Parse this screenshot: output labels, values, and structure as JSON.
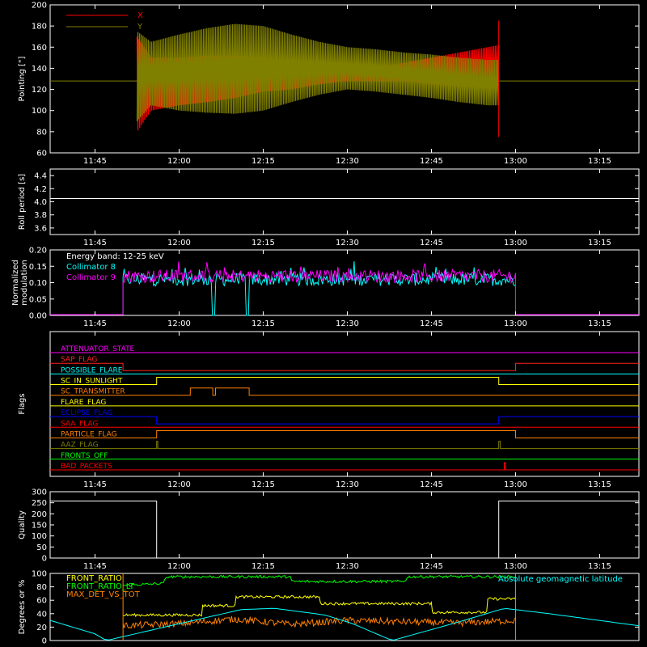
{
  "chart_data": [
    {
      "type": "line",
      "ylabel": "Pointing [\"]",
      "ylim": [
        60,
        200
      ],
      "yticks": [
        "60",
        "80",
        "100",
        "120",
        "140",
        "160",
        "180",
        "200"
      ],
      "xticks": [
        "11:45",
        "12:00",
        "12:15",
        "12:30",
        "12:45",
        "13:00",
        "13:15"
      ],
      "legend_position": "top-left",
      "series": [
        {
          "name": "X",
          "color": "#ff0000",
          "x": [
            "11:52.5",
            "11:55",
            "12:00",
            "12:05",
            "12:10",
            "12:15",
            "12:20",
            "12:25",
            "12:30",
            "12:35",
            "12:40",
            "12:45",
            "12:50",
            "12:55",
            "12:57"
          ],
          "upper": [
            170,
            150,
            150,
            152,
            152,
            150,
            145,
            143,
            140,
            141,
            145,
            150,
            155,
            160,
            162
          ],
          "lower": [
            80,
            100,
            105,
            108,
            112,
            118,
            120,
            125,
            128,
            128,
            128,
            125,
            123,
            122,
            122
          ]
        },
        {
          "name": "Y",
          "color": "#808000",
          "x": [
            "11:52.5",
            "11:55",
            "12:00",
            "12:05",
            "12:10",
            "12:15",
            "12:20",
            "12:25",
            "12:30",
            "12:35",
            "12:40",
            "12:45",
            "12:50",
            "12:55",
            "12:57"
          ],
          "upper": [
            175,
            165,
            172,
            178,
            182,
            180,
            172,
            165,
            160,
            158,
            155,
            153,
            150,
            148,
            148
          ],
          "lower": [
            90,
            105,
            100,
            98,
            97,
            100,
            108,
            115,
            120,
            118,
            115,
            112,
            108,
            105,
            105
          ],
          "baseline": 128
        }
      ]
    },
    {
      "type": "line",
      "ylabel": "Roll period [s]",
      "ylim": [
        3.5,
        4.5
      ],
      "yticks": [
        "3.6",
        "3.8",
        "4.0",
        "4.2",
        "4.4"
      ],
      "xticks": [
        "11:45",
        "12:00",
        "12:15",
        "12:30",
        "12:45",
        "13:00",
        "13:15"
      ],
      "series": [
        {
          "name": "",
          "color": "#ffffff",
          "x": [
            "11:37",
            "13:22"
          ],
          "y": [
            4.05,
            4.05
          ]
        }
      ]
    },
    {
      "type": "line",
      "ylabel": "Normalized modulation",
      "ylim": [
        0.0,
        0.2
      ],
      "yticks": [
        "0.00",
        "0.05",
        "0.10",
        "0.15",
        "0.20"
      ],
      "xticks": [
        "11:45",
        "12:00",
        "12:15",
        "12:30",
        "12:45",
        "13:00",
        "13:15"
      ],
      "annotation": "Energy band: 12-25 keV",
      "legend_position": "top-left",
      "series": [
        {
          "name": "Collimator 8",
          "color": "#00ffff",
          "x_start": "11:50",
          "x_end": "13:00",
          "mean": 0.11,
          "dropouts": [
            [
              "12:06",
              "12:06.3"
            ],
            [
              "12:12",
              "12:12.3"
            ]
          ]
        },
        {
          "name": "Collimator 9",
          "color": "#ff00ff",
          "x_start": "11:50",
          "x_end": "13:00",
          "mean": 0.12
        }
      ]
    },
    {
      "type": "line",
      "ylabel": "Flags",
      "xticks": [
        "11:45",
        "12:00",
        "12:15",
        "12:30",
        "12:45",
        "13:00",
        "13:15"
      ],
      "flags": [
        {
          "name": "ATTENUATOR_STATE",
          "color": "#ff00ff",
          "steps": [
            [
              "11:37",
              0
            ]
          ]
        },
        {
          "name": "SAP_FLAG",
          "color": "#ff2020",
          "steps": [
            [
              "11:37",
              0
            ],
            [
              "11:50",
              -1
            ],
            [
              "13:00",
              0
            ]
          ]
        },
        {
          "name": "POSSIBLE_FLARE",
          "color": "#00ffff",
          "steps": [
            [
              "11:37",
              0
            ]
          ]
        },
        {
          "name": "SC_IN_SUNLIGHT",
          "color": "#ffff00",
          "steps": [
            [
              "11:37",
              0
            ],
            [
              "11:56",
              1
            ],
            [
              "12:57",
              0
            ]
          ]
        },
        {
          "name": "SC_TRANSMITTER",
          "color": "#ff8000",
          "steps": [
            [
              "11:37",
              0
            ],
            [
              "12:02",
              1
            ],
            [
              "12:06",
              0
            ],
            [
              "12:06.5",
              1
            ],
            [
              "12:12.5",
              0
            ]
          ]
        },
        {
          "name": "FLARE_FLAG",
          "color": "#ffff00",
          "steps": [
            [
              "11:37",
              0
            ]
          ]
        },
        {
          "name": "ECLIPSE_FLAG",
          "color": "#0000ff",
          "steps": [
            [
              "11:37",
              0
            ],
            [
              "11:56",
              -1
            ],
            [
              "12:57",
              0
            ]
          ]
        },
        {
          "name": "SAA_FLAG",
          "color": "#ff0000",
          "steps": [
            [
              "11:37",
              0
            ]
          ]
        },
        {
          "name": "PARTICLE_FLAG",
          "color": "#ff8000",
          "steps": [
            [
              "11:37",
              0
            ],
            [
              "11:56",
              1
            ],
            [
              "13:00",
              0
            ]
          ]
        },
        {
          "name": "AAZ_FLAG",
          "color": "#808000",
          "steps": [
            [
              "11:37",
              0
            ],
            [
              "11:56",
              1
            ],
            [
              "11:56.2",
              0
            ],
            [
              "12:57",
              1
            ],
            [
              "12:57.3",
              0
            ]
          ]
        },
        {
          "name": "FRONTS_OFF",
          "color": "#00ff00",
          "steps": [
            [
              "11:37",
              0
            ]
          ]
        },
        {
          "name": "BAD_PACKETS",
          "color": "#ff0000",
          "steps": [
            [
              "11:37",
              0
            ],
            [
              "12:58",
              1
            ],
            [
              "12:58.2",
              0
            ]
          ]
        }
      ]
    },
    {
      "type": "line",
      "ylabel": "Quality",
      "ylim": [
        0,
        300
      ],
      "yticks": [
        "0",
        "50",
        "100",
        "150",
        "200",
        "250",
        "300"
      ],
      "xticks": [
        "11:45",
        "12:00",
        "12:15",
        "12:30",
        "12:45",
        "13:00",
        "13:15"
      ],
      "series": [
        {
          "name": "",
          "color": "#ffffff",
          "x": [
            "11:37",
            "11:56",
            "11:56",
            "12:57",
            "12:57",
            "13:22"
          ],
          "y": [
            258,
            258,
            0,
            0,
            258,
            258
          ]
        }
      ]
    },
    {
      "type": "line",
      "ylabel": "Degrees or %",
      "ylim": [
        0,
        100
      ],
      "yticks": [
        "0",
        "20",
        "40",
        "60",
        "80",
        "100"
      ],
      "legend_position": "top-left",
      "series": [
        {
          "name": "FRONT_RATIO",
          "color": "#ffff00",
          "x": [
            "11:50",
            "12:04",
            "12:04",
            "12:10",
            "12:10",
            "12:25",
            "12:25",
            "12:45",
            "12:45",
            "12:55",
            "12:55",
            "13:00"
          ],
          "y": [
            38,
            38,
            52,
            52,
            65,
            65,
            55,
            55,
            42,
            42,
            62,
            62
          ]
        },
        {
          "name": "FRONT_RATIO_LT",
          "color": "#00ff00",
          "x": [
            "11:50",
            "11:57",
            "11:58",
            "12:20",
            "12:20",
            "12:40",
            "12:41",
            "13:00"
          ],
          "y": [
            82,
            85,
            95,
            95,
            88,
            88,
            95,
            95
          ]
        },
        {
          "name": "MAX_DET_VS_TOT",
          "color": "#ff8000",
          "x": [
            "11:50",
            "12:00",
            "12:10",
            "12:20",
            "12:30",
            "12:40",
            "12:50",
            "13:00"
          ],
          "y": [
            22,
            25,
            32,
            24,
            30,
            28,
            26,
            30
          ]
        },
        {
          "name": "Absolute geomagnetic latitude",
          "color": "#00ffff",
          "x": [
            "11:37",
            "11:45",
            "11:47",
            "12:00",
            "12:11",
            "12:17",
            "12:26",
            "12:31",
            "12:38",
            "12:50",
            "12:58",
            "13:06",
            "13:22"
          ],
          "y": [
            30,
            10,
            0,
            25,
            46,
            48,
            38,
            25,
            0,
            28,
            48,
            40,
            22
          ]
        }
      ]
    }
  ]
}
